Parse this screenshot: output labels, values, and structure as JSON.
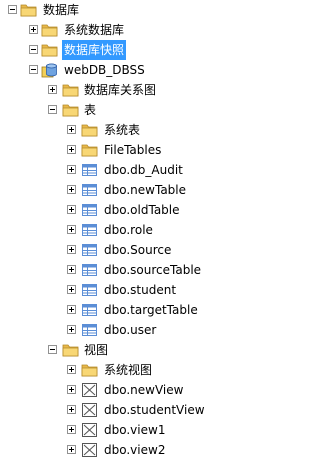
{
  "tree": [
    {
      "label": "数据库",
      "toggle": "minus",
      "icon": "folder-icon",
      "level": 0
    },
    {
      "label": "系统数据库",
      "toggle": "plus",
      "icon": "folder-icon",
      "level": 1
    },
    {
      "label": "数据库快照",
      "toggle": "minus",
      "icon": "folder-icon",
      "level": 1,
      "selected": true
    },
    {
      "label": "webDB_DBSS",
      "toggle": "minus",
      "icon": "database-snapshot-icon",
      "level": 2
    },
    {
      "label": "数据库关系图",
      "toggle": "plus",
      "icon": "folder-icon",
      "level": 3
    },
    {
      "label": "表",
      "toggle": "minus",
      "icon": "folder-icon",
      "level": 3
    },
    {
      "label": "系统表",
      "toggle": "plus",
      "icon": "folder-icon",
      "level": 4
    },
    {
      "label": "FileTables",
      "toggle": "plus",
      "icon": "folder-icon",
      "level": 4
    },
    {
      "label": "dbo.db_Audit",
      "toggle": "plus",
      "icon": "table-icon",
      "level": 4
    },
    {
      "label": "dbo.newTable",
      "toggle": "plus",
      "icon": "table-icon",
      "level": 4
    },
    {
      "label": "dbo.oldTable",
      "toggle": "plus",
      "icon": "table-icon",
      "level": 4
    },
    {
      "label": "dbo.role",
      "toggle": "plus",
      "icon": "table-icon",
      "level": 4
    },
    {
      "label": "dbo.Source",
      "toggle": "plus",
      "icon": "table-icon",
      "level": 4
    },
    {
      "label": "dbo.sourceTable",
      "toggle": "plus",
      "icon": "table-icon",
      "level": 4
    },
    {
      "label": "dbo.student",
      "toggle": "plus",
      "icon": "table-icon",
      "level": 4
    },
    {
      "label": "dbo.targetTable",
      "toggle": "plus",
      "icon": "table-icon",
      "level": 4
    },
    {
      "label": "dbo.user",
      "toggle": "plus",
      "icon": "table-icon",
      "level": 4
    },
    {
      "label": "视图",
      "toggle": "minus",
      "icon": "folder-icon",
      "level": 3
    },
    {
      "label": "系统视图",
      "toggle": "plus",
      "icon": "folder-icon",
      "level": 4
    },
    {
      "label": "dbo.newView",
      "toggle": "plus",
      "icon": "view-icon",
      "level": 4
    },
    {
      "label": "dbo.studentView",
      "toggle": "plus",
      "icon": "view-icon",
      "level": 4
    },
    {
      "label": "dbo.view1",
      "toggle": "plus",
      "icon": "view-icon",
      "level": 4
    },
    {
      "label": "dbo.view2",
      "toggle": "plus",
      "icon": "view-icon",
      "level": 4
    }
  ],
  "colors": {
    "selection": "#3399ff",
    "selection_text": "#ffffff",
    "folder_fill": "#f8d775",
    "folder_tab": "#e8b84a",
    "table_blue": "#5b8ed6",
    "view_border": "#555555"
  }
}
